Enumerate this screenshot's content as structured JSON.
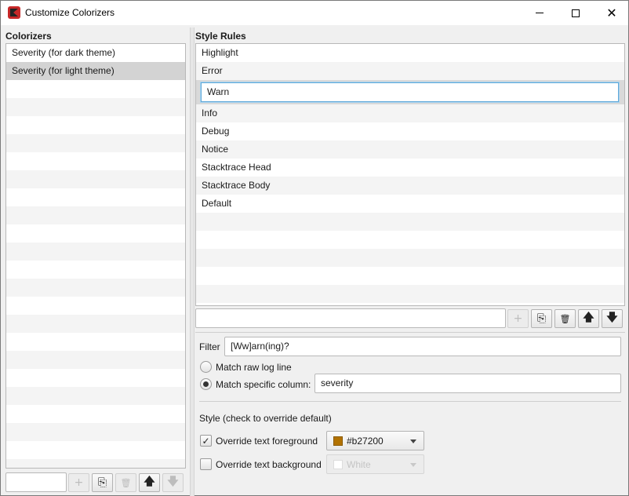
{
  "window": {
    "title": "Customize Colorizers"
  },
  "colorizers": {
    "label": "Colorizers",
    "items": [
      "Severity (for dark theme)",
      "Severity (for light theme)"
    ],
    "selected_index": 1,
    "filter_value": ""
  },
  "style_rules": {
    "label": "Style Rules",
    "items": [
      "Highlight",
      "Error",
      "Warn",
      "Info",
      "Debug",
      "Notice",
      "Stacktrace Head",
      "Stacktrace Body",
      "Default"
    ],
    "editing_index": 2,
    "filter_value": ""
  },
  "rule_editor": {
    "filter_label": "Filter",
    "filter_value": "[Ww]arn(ing)?",
    "match_raw_label": "Match raw log line",
    "match_column_label": "Match specific column:",
    "column_value": "severity",
    "selected_match": "column",
    "style_heading": "Style (check to override default)",
    "override_fg_label": "Override text foreground",
    "override_fg_checked": true,
    "fg_color": "#b27200",
    "fg_color_label": "#b27200",
    "override_bg_label": "Override text background",
    "override_bg_checked": false,
    "bg_color_label": "White"
  },
  "icons": {
    "add": "+",
    "copy": "⎘",
    "delete": "🗑",
    "up": "🡅",
    "down": "🡇",
    "check": "✓",
    "close": "✕"
  }
}
